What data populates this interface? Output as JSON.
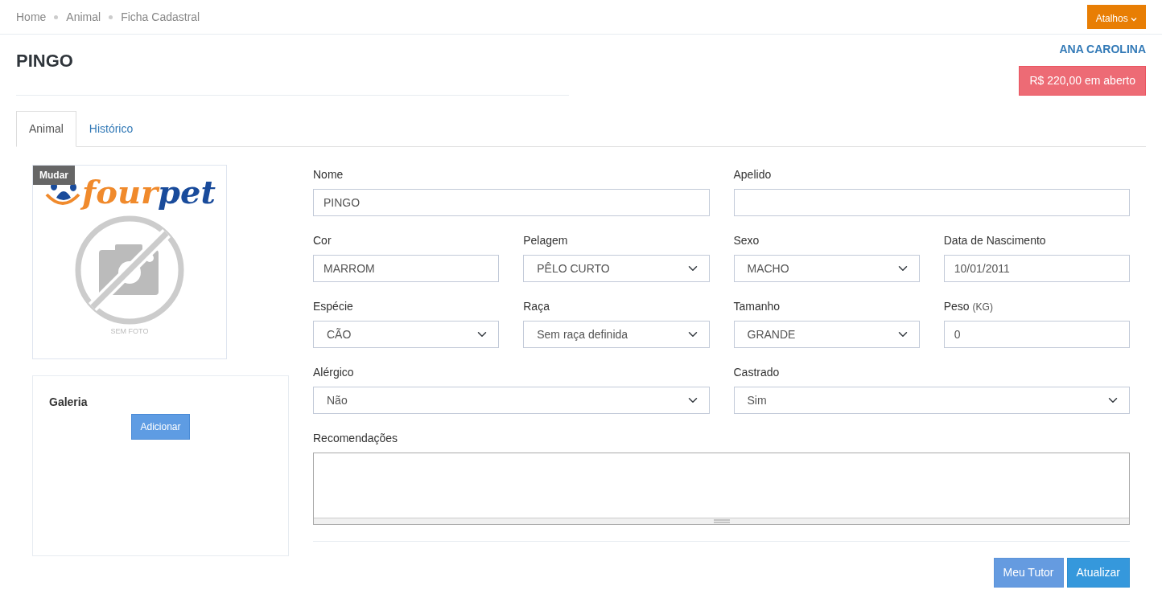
{
  "breadcrumb": [
    {
      "label": "Home"
    },
    {
      "label": "Animal"
    },
    {
      "label": "Ficha Cadastral"
    }
  ],
  "shortcuts_button": {
    "label": "Atalhos"
  },
  "title": "PINGO",
  "owner": {
    "name": "ANA CAROLINA",
    "balance": "R$ 220,00 em aberto"
  },
  "tabs": [
    {
      "label": "Animal",
      "selected": true
    },
    {
      "label": "Histórico",
      "selected": false
    }
  ],
  "photo": {
    "change_label": "Mudar",
    "logo_text_1": "four",
    "logo_text_2": "pet",
    "no_photo_caption": "SEM FOTO"
  },
  "gallery": {
    "title": "Galeria",
    "add_button": "Adicionar"
  },
  "form": {
    "rows": [
      [
        {
          "label": "Nome",
          "kind": "input",
          "value": "PINGO"
        },
        {
          "label": "Apelido",
          "kind": "input"
        }
      ],
      [
        {
          "label": "Cor",
          "kind": "input",
          "value": "MARROM"
        },
        {
          "label": "Pelagem",
          "kind": "select",
          "value": "PÊLO CURTO"
        },
        {
          "label": "Sexo",
          "kind": "select",
          "value": "MACHO"
        },
        {
          "label": "Data de Nascimento",
          "kind": "input",
          "value": "10/01/2011"
        }
      ],
      [
        {
          "label": "Espécie",
          "kind": "select",
          "value": "CÃO"
        },
        {
          "label": "Raça",
          "kind": "select",
          "value": "Sem raça definida"
        },
        {
          "label": "Tamanho",
          "kind": "select",
          "value": "GRANDE"
        },
        {
          "label": "Peso",
          "unit": "(KG)",
          "kind": "input",
          "value": "0"
        }
      ],
      [
        {
          "label": "Alérgico",
          "kind": "select",
          "value": "Não"
        },
        {
          "label": "Castrado",
          "kind": "select",
          "value": "Sim"
        }
      ],
      [
        {
          "label": "Recomendações",
          "kind": "textarea"
        }
      ]
    ],
    "buttons": [
      {
        "label": "Meu Tutor",
        "kind": "secondary"
      },
      {
        "label": "Atualizar",
        "kind": "primary"
      }
    ]
  }
}
